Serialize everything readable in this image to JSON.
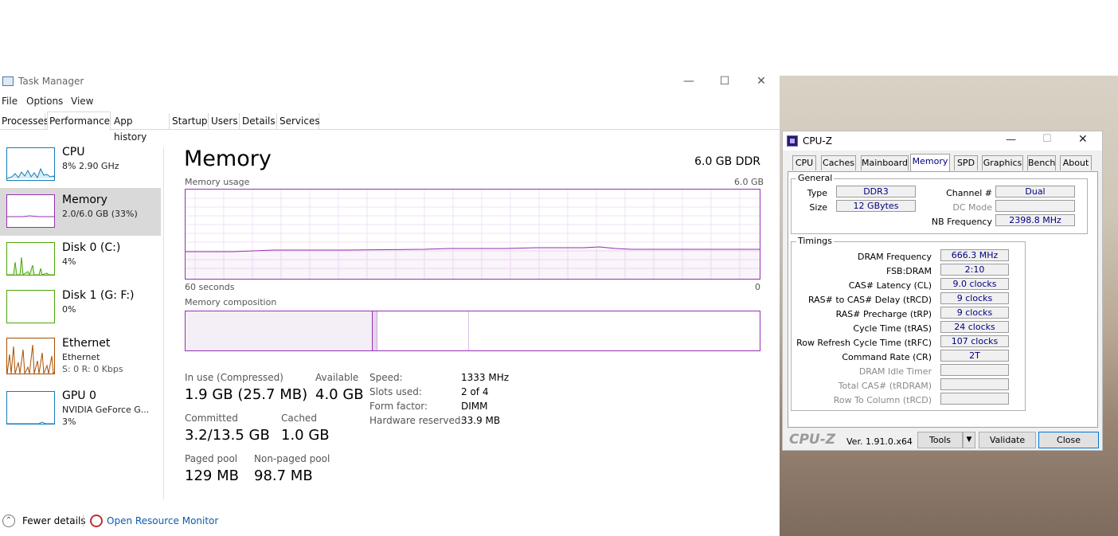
{
  "taskmgr": {
    "title": "Task Manager",
    "menus": [
      "File",
      "Options",
      "View"
    ],
    "tabs": [
      "Processes",
      "Performance",
      "App history",
      "Startup",
      "Users",
      "Details",
      "Services"
    ],
    "sidebar": [
      {
        "name": "CPU",
        "sub1": "8% 2.90 GHz",
        "sub2": ""
      },
      {
        "name": "Memory",
        "sub1": "2.0/6.0 GB (33%)",
        "sub2": ""
      },
      {
        "name": "Disk 0 (C:)",
        "sub1": "4%",
        "sub2": ""
      },
      {
        "name": "Disk 1 (G: F:)",
        "sub1": "0%",
        "sub2": ""
      },
      {
        "name": "Ethernet",
        "sub1": "Ethernet",
        "sub2": "S: 0 R: 0 Kbps"
      },
      {
        "name": "GPU 0",
        "sub1": "NVIDIA GeForce G...",
        "sub2": "3%"
      }
    ],
    "main": {
      "title": "Memory",
      "total": "6.0 GB DDR",
      "usage_label": "Memory usage",
      "usage_max": "6.0 GB",
      "axis_left": "60 seconds",
      "axis_right": "0",
      "composition_label": "Memory composition",
      "stats": {
        "in_use_label": "In use (Compressed)",
        "in_use": "1.9 GB (25.7 MB)",
        "available_label": "Available",
        "available": "4.0 GB",
        "committed_label": "Committed",
        "committed": "3.2/13.5 GB",
        "cached_label": "Cached",
        "cached": "1.0 GB",
        "paged_label": "Paged pool",
        "paged": "129 MB",
        "nonpaged_label": "Non-paged pool",
        "nonpaged": "98.7 MB"
      },
      "details": [
        {
          "k": "Speed:",
          "v": "1333 MHz"
        },
        {
          "k": "Slots used:",
          "v": "2 of 4"
        },
        {
          "k": "Form factor:",
          "v": "DIMM"
        },
        {
          "k": "Hardware reserved:",
          "v": "33.9 MB"
        }
      ]
    },
    "footer": {
      "fewer": "Fewer details",
      "resmon": "Open Resource Monitor"
    },
    "colors": {
      "memory": "#9630b3",
      "cpu": "#117dbb",
      "disk": "#4da60c",
      "ethernet": "#a74f01",
      "gpu": "#117dbb"
    }
  },
  "cpuz": {
    "title": "CPU-Z",
    "tabs": [
      "CPU",
      "Caches",
      "Mainboard",
      "Memory",
      "SPD",
      "Graphics",
      "Bench",
      "About"
    ],
    "general": {
      "label": "General",
      "type_l": "Type",
      "type": "DDR3",
      "size_l": "Size",
      "size": "12 GBytes",
      "channel_l": "Channel #",
      "channel": "Dual",
      "dc_l": "DC Mode",
      "dc": "",
      "nb_l": "NB Frequency",
      "nb": "2398.8 MHz"
    },
    "timings": {
      "label": "Timings",
      "rows": [
        {
          "l": "DRAM Frequency",
          "v": "666.3 MHz",
          "dim": false
        },
        {
          "l": "FSB:DRAM",
          "v": "2:10",
          "dim": false
        },
        {
          "l": "CAS# Latency (CL)",
          "v": "9.0 clocks",
          "dim": false
        },
        {
          "l": "RAS# to CAS# Delay (tRCD)",
          "v": "9 clocks",
          "dim": false
        },
        {
          "l": "RAS# Precharge (tRP)",
          "v": "9 clocks",
          "dim": false
        },
        {
          "l": "Cycle Time (tRAS)",
          "v": "24 clocks",
          "dim": false
        },
        {
          "l": "Row Refresh Cycle Time (tRFC)",
          "v": "107 clocks",
          "dim": false
        },
        {
          "l": "Command Rate (CR)",
          "v": "2T",
          "dim": false
        },
        {
          "l": "DRAM Idle Timer",
          "v": "",
          "dim": true
        },
        {
          "l": "Total CAS# (tRDRAM)",
          "v": "",
          "dim": true
        },
        {
          "l": "Row To Column (tRCD)",
          "v": "",
          "dim": true
        }
      ]
    },
    "footer": {
      "brand": "CPU-Z",
      "version": "Ver. 1.91.0.x64",
      "tools": "Tools",
      "validate": "Validate",
      "close": "Close"
    }
  }
}
